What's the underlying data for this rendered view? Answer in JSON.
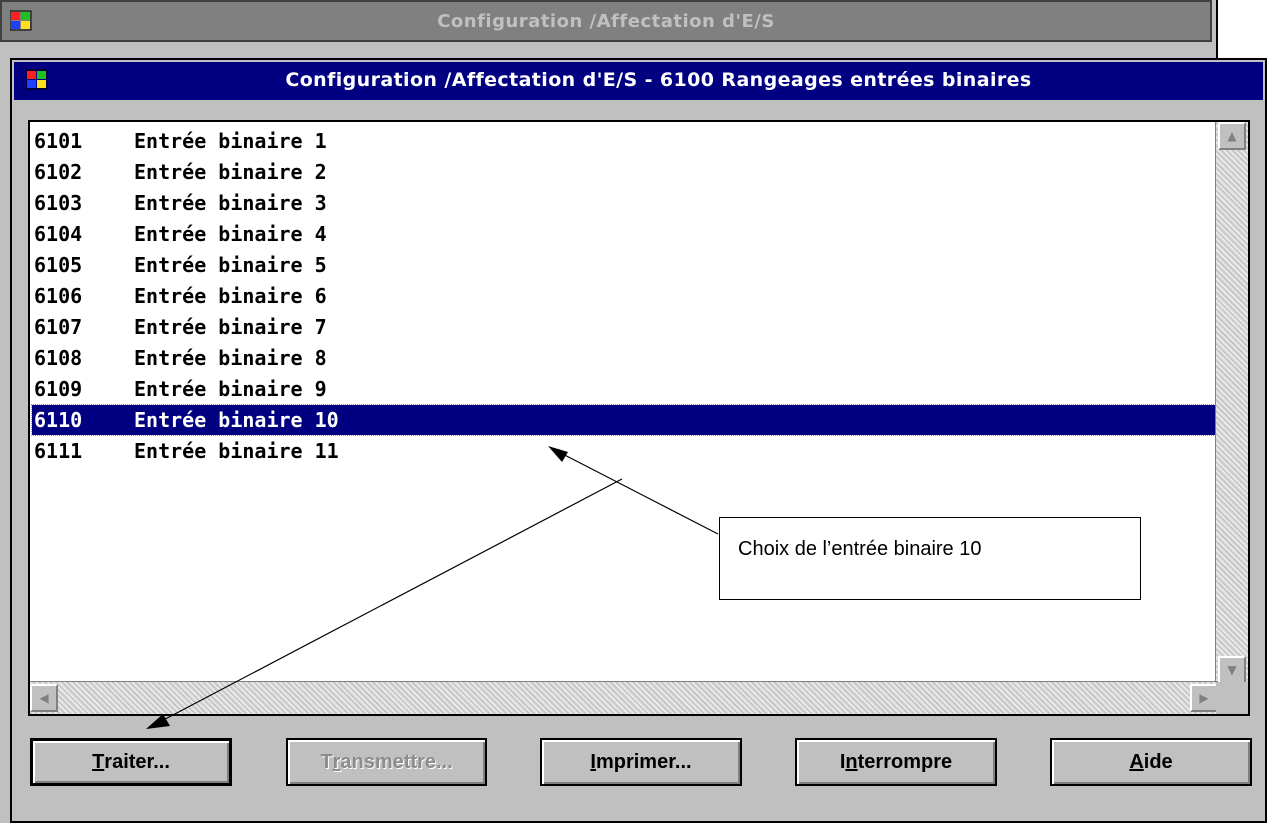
{
  "outer_window": {
    "title": "Configuration /Affectation d'E/S"
  },
  "dialog": {
    "title": "Configuration /Affectation d'E/S - 6100  Rangeages entrées binaires",
    "list_items": [
      {
        "code": "6101",
        "label": "Entrée binaire 1"
      },
      {
        "code": "6102",
        "label": "Entrée binaire 2"
      },
      {
        "code": "6103",
        "label": "Entrée binaire 3"
      },
      {
        "code": "6104",
        "label": "Entrée binaire 4"
      },
      {
        "code": "6105",
        "label": "Entrée binaire 5"
      },
      {
        "code": "6106",
        "label": "Entrée binaire 6"
      },
      {
        "code": "6107",
        "label": "Entrée binaire 7"
      },
      {
        "code": "6108",
        "label": "Entrée binaire 8"
      },
      {
        "code": "6109",
        "label": "Entrée binaire 9"
      },
      {
        "code": "6110",
        "label": "Entrée binaire 10"
      },
      {
        "code": "6111",
        "label": "Entrée binaire 11"
      }
    ],
    "selected_index": 9
  },
  "buttons": {
    "traiter": {
      "hotkey": "T",
      "rest": "raiter..."
    },
    "transmettre": {
      "prefix": "T",
      "hotkey": "r",
      "rest": "ansmettre..."
    },
    "imprimer": {
      "hotkey": "I",
      "rest": "mprimer..."
    },
    "interrompre": {
      "prefix": "I",
      "hotkey": "n",
      "rest": "terrompre"
    },
    "aide": {
      "hotkey": "A",
      "rest": "ide"
    }
  },
  "annotation": {
    "text": "Choix de l’entrée binaire 10"
  },
  "colors": {
    "title_active": "#000080",
    "title_inactive": "#808080",
    "face": "#c0c0c0",
    "selection": "#000080"
  },
  "icons": {
    "app_icon": "windows-flag-icon",
    "scroll_up": "triangle-up-icon",
    "scroll_down": "triangle-down-icon",
    "scroll_left": "triangle-left-icon",
    "scroll_right": "triangle-right-icon"
  }
}
